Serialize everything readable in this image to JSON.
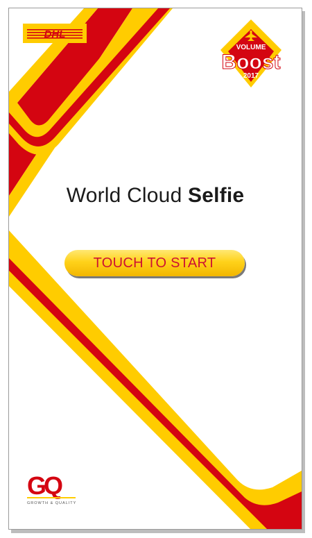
{
  "app": {
    "title_regular": "World Cloud",
    "title_bold": "Selfie",
    "start_button_label": "TOUCH TO START"
  },
  "logos": {
    "dhl": "DHL",
    "boost_top": "VOLUME",
    "boost_main": "Boost",
    "boost_year": "2017",
    "gq_letters": "GQ",
    "gq_tagline": "GROWTH & QUALITY"
  },
  "colors": {
    "yellow": "#FFCC00",
    "red": "#D40511",
    "text": "#1a1a1a"
  },
  "icons": [
    "dhl-logo",
    "volume-boost-badge",
    "gq-logo",
    "airplane-icon"
  ]
}
